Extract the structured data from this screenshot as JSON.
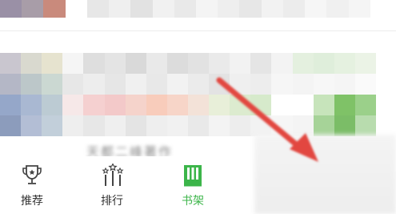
{
  "colors": {
    "accent_green": "#3cb54a",
    "inactive_label": "#333333",
    "inactive_icon": "#444444",
    "arrow_red": "#e2463f"
  },
  "bottom_nav": {
    "items": [
      {
        "label": "推荐",
        "icon": "trophy-icon",
        "active": false
      },
      {
        "label": "排行",
        "icon": "ranking-icon",
        "active": false
      },
      {
        "label": "书架",
        "icon": "bookshelf-icon",
        "active": true
      }
    ]
  },
  "mosaic_caption": "天都二峰著作"
}
